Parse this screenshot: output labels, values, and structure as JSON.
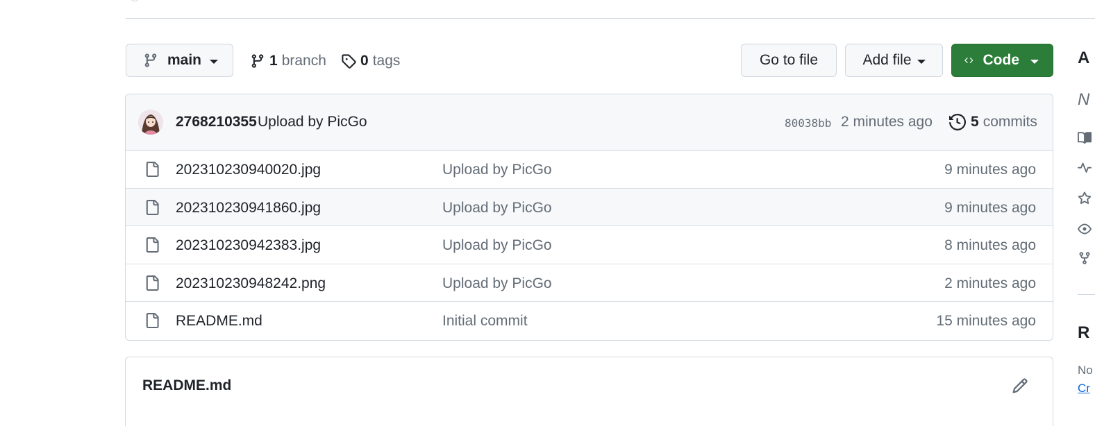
{
  "toolbar": {
    "branch": "main",
    "branches_count": "1",
    "branches_label": "branch",
    "tags_count": "0",
    "tags_label": "tags",
    "goto_file": "Go to file",
    "add_file": "Add file",
    "code": "Code"
  },
  "latest_commit": {
    "author": "2768210355",
    "message": "Upload by PicGo",
    "sha": "80038bb",
    "time": "2 minutes ago",
    "commits_count": "5",
    "commits_label": "commits"
  },
  "files": [
    {
      "name": "202310230940020.jpg",
      "message": "Upload by PicGo",
      "age": "9 minutes ago"
    },
    {
      "name": "202310230941860.jpg",
      "message": "Upload by PicGo",
      "age": "9 minutes ago"
    },
    {
      "name": "202310230942383.jpg",
      "message": "Upload by PicGo",
      "age": "8 minutes ago"
    },
    {
      "name": "202310230948242.png",
      "message": "Upload by PicGo",
      "age": "2 minutes ago"
    },
    {
      "name": "README.md",
      "message": "Initial commit",
      "age": "15 minutes ago"
    }
  ],
  "readme": {
    "title": "README.md"
  },
  "sidebar": {
    "about": "A",
    "description": "N",
    "releases": "R",
    "no_releases": "No",
    "create": "Cr"
  },
  "colors": {
    "code_button": "#2b7d39",
    "border": "#d0d7de",
    "muted_text": "#636c76"
  }
}
